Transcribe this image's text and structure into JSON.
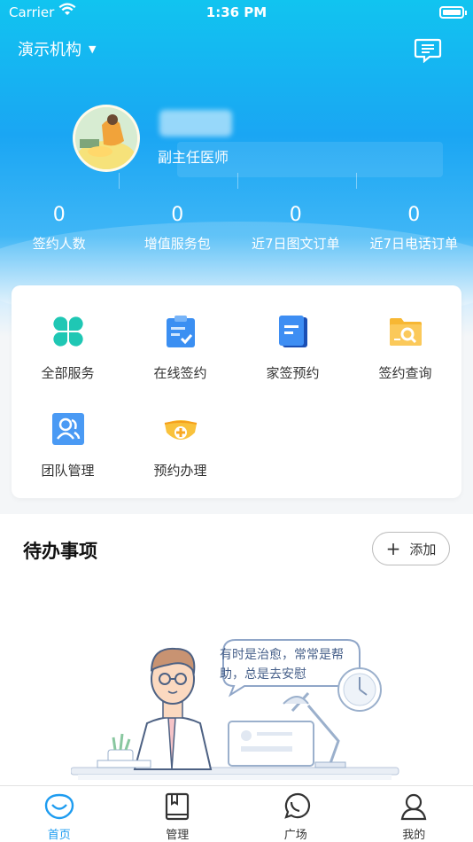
{
  "status_bar": {
    "carrier": "Carrier",
    "time": "1:36 PM"
  },
  "header": {
    "org_name": "演示机构",
    "profile_title": "副主任医师"
  },
  "stats": [
    {
      "value": "0",
      "label": "签约人数"
    },
    {
      "value": "0",
      "label": "增值服务包"
    },
    {
      "value": "0",
      "label": "近7日图文订单"
    },
    {
      "value": "0",
      "label": "近7日电话订单"
    }
  ],
  "services": [
    {
      "label": "全部服务",
      "icon": "clover-icon"
    },
    {
      "label": "在线签约",
      "icon": "clipboard-check-icon"
    },
    {
      "label": "家签预约",
      "icon": "document-icon"
    },
    {
      "label": "签约查询",
      "icon": "folder-search-icon"
    },
    {
      "label": "团队管理",
      "icon": "team-icon"
    },
    {
      "label": "预约办理",
      "icon": "mask-plus-icon"
    }
  ],
  "todo": {
    "title": "待办事项",
    "add_label": "添加",
    "quote": "有时是治愈，常常是帮助，总是去安慰"
  },
  "tabbar": [
    {
      "label": "首页",
      "icon": "heart-chat-icon",
      "active": true
    },
    {
      "label": "管理",
      "icon": "book-icon",
      "active": false
    },
    {
      "label": "广场",
      "icon": "whatsapp-chat-icon",
      "active": false
    },
    {
      "label": "我的",
      "icon": "person-icon",
      "active": false
    }
  ],
  "colors": {
    "accent": "#1e9cf0",
    "header_top": "#11c4f0"
  }
}
